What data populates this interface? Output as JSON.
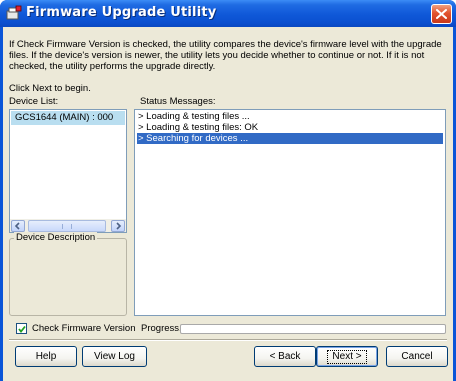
{
  "window": {
    "title": "Firmware Upgrade Utility"
  },
  "description": {
    "text": "If Check Firmware Version is checked, the utility compares the device's firmware level with the upgrade files. If the device's version is newer, the utility lets you decide whether to continue or not. If it is not checked, the utility performs the upgrade directly.",
    "instruction": "Click Next to begin."
  },
  "device_list": {
    "label": "Device List:",
    "items": [
      "GCS1644 (MAIN) : 000"
    ]
  },
  "device_description": {
    "label": "Device Description"
  },
  "status": {
    "label": "Status Messages:",
    "lines": [
      "> Loading & testing files ...",
      "> Loading & testing files: OK",
      "> Searching for devices ..."
    ]
  },
  "options": {
    "check_firmware_label": "Check Firmware Version",
    "check_firmware_checked": true,
    "progress_label": "Progress...",
    "progress_value": 0
  },
  "buttons": {
    "help": "Help",
    "view_log": "View Log",
    "back": "< Back",
    "next": "Next >",
    "cancel": "Cancel"
  },
  "colors": {
    "titlebar": "#0f58d8",
    "selection": "#316ac5",
    "device_highlight": "#b9def0",
    "dialog_face": "#ece9d8"
  }
}
